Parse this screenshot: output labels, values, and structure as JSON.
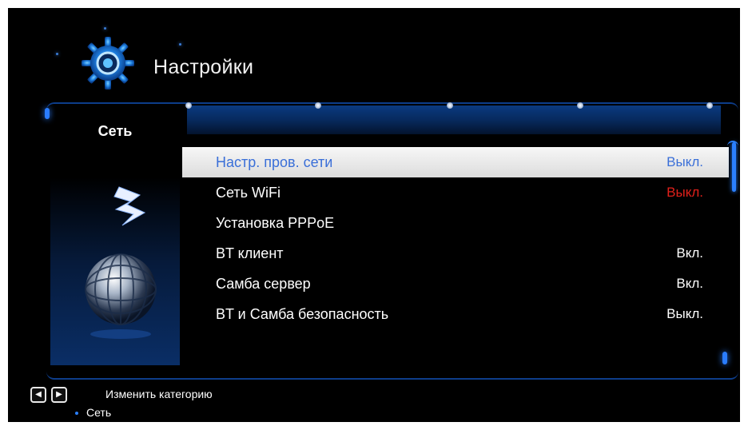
{
  "header": {
    "title": "Настройки",
    "icon": "gear-icon"
  },
  "category": {
    "label": "Сеть",
    "art_icon": "globe-lightning-icon"
  },
  "tabs": {
    "count": 5
  },
  "menu": {
    "items": [
      {
        "label": "Настр. пров. сети",
        "value": "Выкл.",
        "selected": true
      },
      {
        "label": "Сеть WiFi",
        "value": "Выкл.",
        "value_color": "#e0201b"
      },
      {
        "label": "Установка PPPoE",
        "value": ""
      },
      {
        "label": "BT клиент",
        "value": "Вкл."
      },
      {
        "label": "Самба сервер",
        "value": "Вкл."
      },
      {
        "label": "BT и Самба безопасность",
        "value": "Выкл."
      }
    ]
  },
  "footer": {
    "left_key": "◀",
    "right_key": "▶",
    "hint": "Изменить категорию",
    "current": "Сеть"
  },
  "colors": {
    "accent": "#2b80ff",
    "selected_text": "#3a6fd8",
    "warning": "#e0201b",
    "background": "#000000"
  }
}
